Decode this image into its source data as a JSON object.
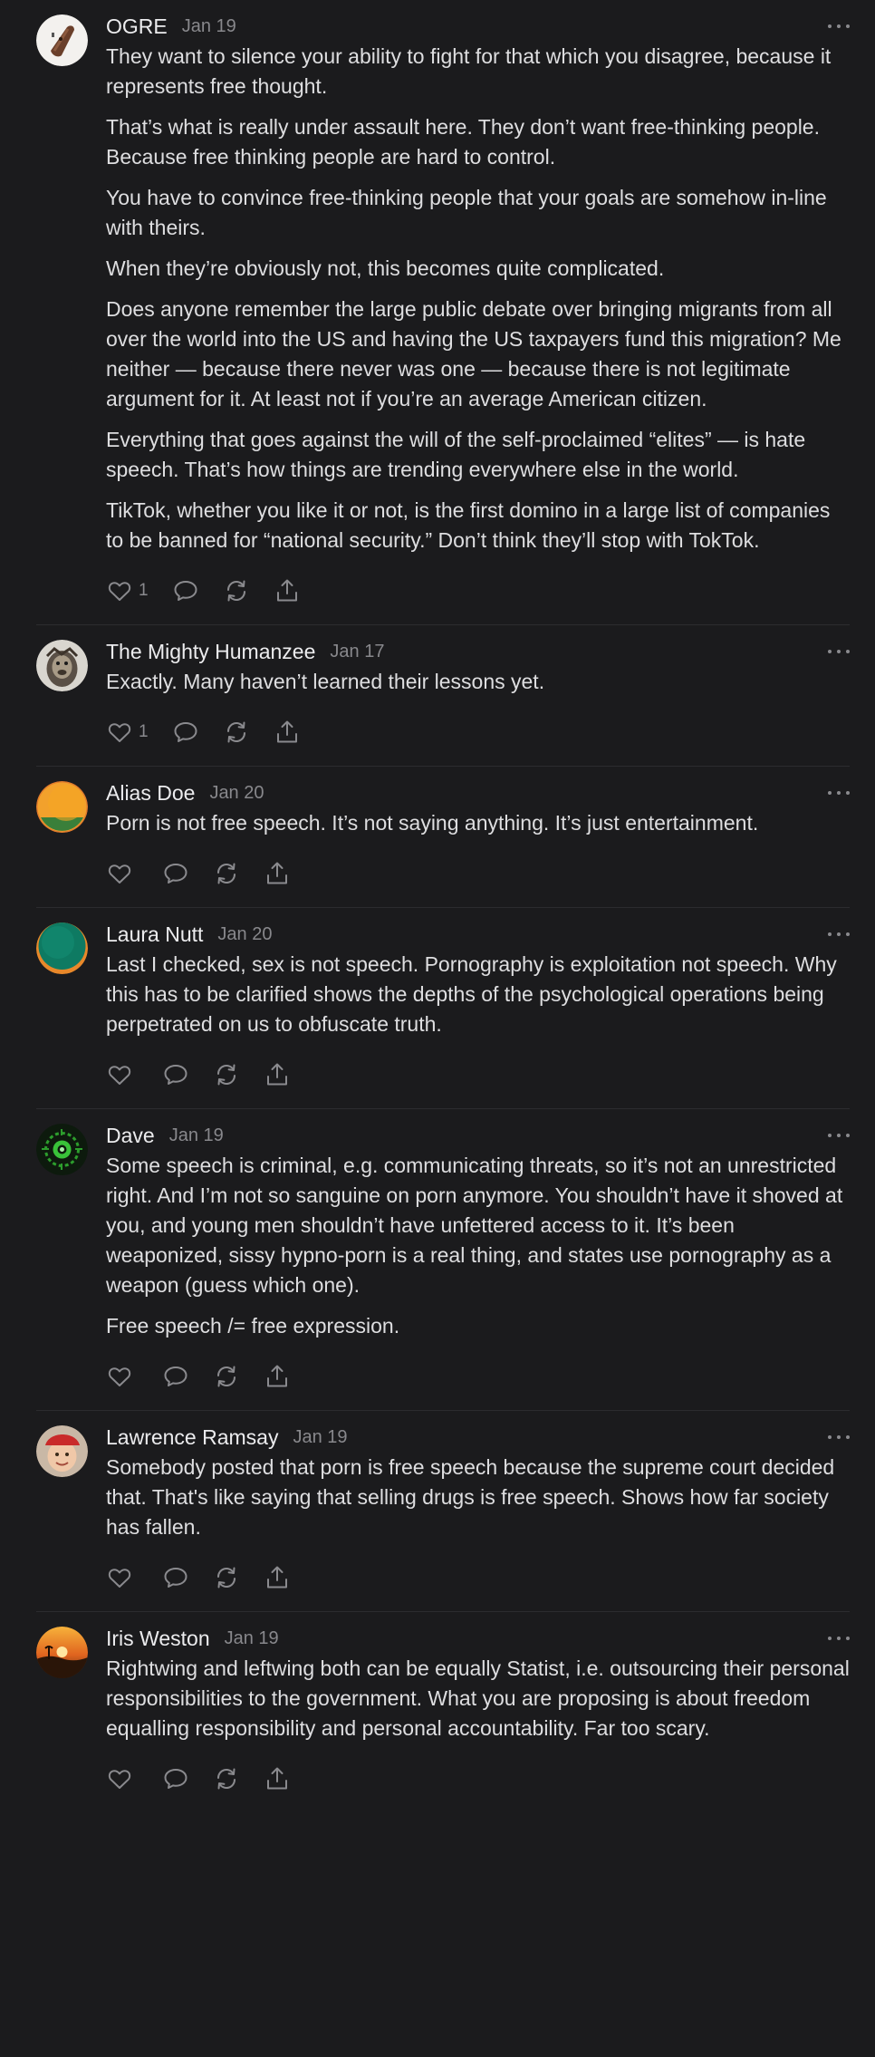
{
  "comments": [
    {
      "author": "OGRE",
      "date": "Jan 19",
      "likes": "1",
      "avatar": "ogre",
      "paragraphs": [
        "They want to silence your ability to fight for that which you disagree, because it represents free thought.",
        "That’s what is really under assault here. They don’t want free-thinking people. Because free thinking people are hard to control.",
        "You have to convince free-thinking people that your goals are somehow in-line with theirs.",
        "When they’re obviously not, this becomes quite complicated.",
        "Does anyone remember the large public debate over bringing migrants from all over the world into the US and having the US taxpayers fund this migration? Me neither — because there never was one — because there is not legitimate argument for it. At least not if you’re an average American citizen.",
        "Everything that goes against the will of the self-proclaimed “elites” — is hate speech. That’s how things are trending everywhere else in the world.",
        "TikTok, whether you like it or not, is the first domino in a large list of companies to be banned for “national security.” Don’t think they’ll stop with TokTok."
      ]
    },
    {
      "author": "The Mighty Humanzee",
      "date": "Jan 17",
      "likes": "1",
      "avatar": "humanzee",
      "paragraphs": [
        "Exactly. Many haven’t learned their lessons yet."
      ]
    },
    {
      "author": "Alias Doe",
      "date": "Jan 20",
      "likes": "",
      "avatar": "alias",
      "paragraphs": [
        "Porn is not free speech. It’s not saying anything. It’s just entertainment."
      ]
    },
    {
      "author": "Laura Nutt",
      "date": "Jan 20",
      "likes": "",
      "avatar": "laura",
      "paragraphs": [
        "Last I checked, sex is not speech. Pornography is exploitation not speech. Why this has to be clarified shows the depths of the psychological operations being perpetrated on us to obfuscate truth."
      ]
    },
    {
      "author": "Dave",
      "date": "Jan 19",
      "likes": "",
      "avatar": "dave",
      "paragraphs": [
        "Some speech is criminal, e.g. communicating threats, so it’s not an unrestricted right. And I’m not so sanguine on porn anymore. You shouldn’t have it shoved at you, and young men shouldn’t have unfettered access to it. It’s been weaponized, sissy hypno-porn is a real thing, and states use pornography as a weapon (guess which one).",
        "Free speech /= free expression."
      ]
    },
    {
      "author": "Lawrence Ramsay",
      "date": "Jan 19",
      "likes": "",
      "avatar": "lawrence",
      "paragraphs": [
        "Somebody posted that porn is free speech because the supreme court decided that. That's like saying that selling drugs is free speech. Shows how far society has fallen."
      ]
    },
    {
      "author": "Iris Weston",
      "date": "Jan 19",
      "likes": "",
      "avatar": "iris",
      "paragraphs": [
        "Rightwing and leftwing both can be equally Statist, i.e. outsourcing their personal responsibilities to the government. What you are proposing is about freedom equalling responsibility and personal accountability. Far too scary."
      ]
    }
  ]
}
